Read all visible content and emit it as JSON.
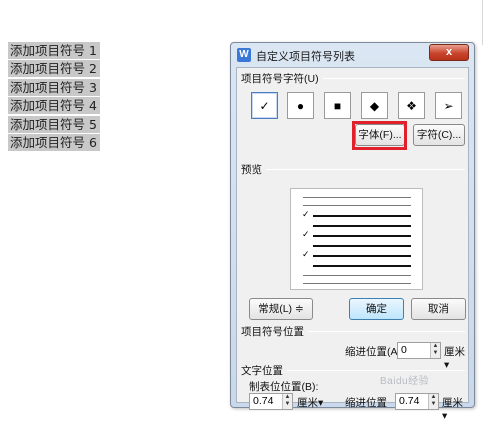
{
  "document": {
    "items": [
      "添加项目符号 1",
      "添加项目符号 2",
      "添加项目符号 3",
      "添加项目符号 4",
      "添加项目符号 5",
      "添加项目符号 6"
    ]
  },
  "dialog": {
    "title": "自定义项目符号列表",
    "close_label": "x",
    "bullet_section_label": "项目符号字符(U)",
    "bullet_symbols": [
      "✓",
      "●",
      "■",
      "◆",
      "❖",
      "➢"
    ],
    "selected_index": 0,
    "font_button": "字体(F)...",
    "char_button": "字符(C)...",
    "preview_label": "预览",
    "normal_button": "常规(L) ≑",
    "ok_button": "确定",
    "cancel_button": "取消",
    "bullet_position_label": "项目符号位置",
    "indent_label": "缩进位置(A):",
    "indent_value": "0",
    "indent_unit": "厘米▾",
    "text_position_label": "文字位置",
    "tab_label": "制表位位置(B):",
    "tab_value": "0.74",
    "tab_unit": "厘米▾",
    "text_indent_label": "缩进位置",
    "text_indent_value": "0.74",
    "text_indent_unit": "厘米▾"
  },
  "watermark": "Baidu经验",
  "colors": {
    "accent_highlight": "#e0202a",
    "title_gradient": "#c9d8ea",
    "close_button": "#c9442c"
  }
}
